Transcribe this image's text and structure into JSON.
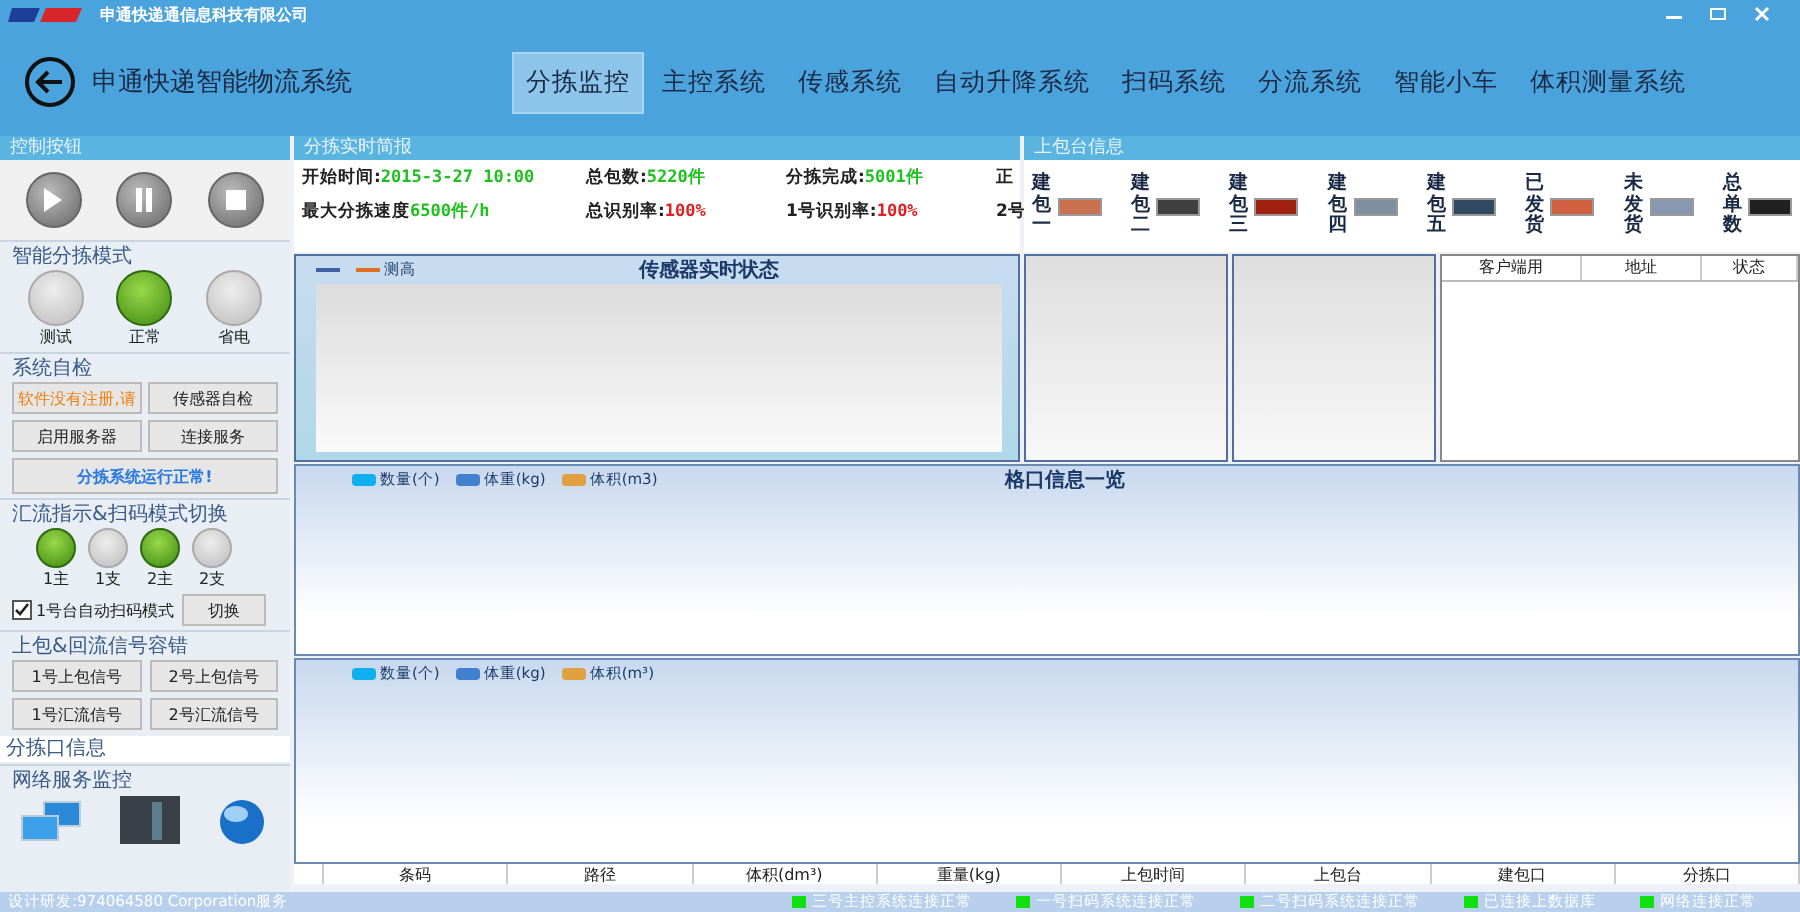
{
  "window": {
    "company": "申通快递通信息科技有限公司",
    "title": "申通快递智能物流系统"
  },
  "tabs": [
    {
      "label": "分拣监控",
      "selected": true
    },
    {
      "label": "主控系统",
      "selected": false
    },
    {
      "label": "传感系统",
      "selected": false
    },
    {
      "label": "自动升降系统",
      "selected": false
    },
    {
      "label": "扫码系统",
      "selected": false
    },
    {
      "label": "分流系统",
      "selected": false
    },
    {
      "label": "智能小车",
      "selected": false
    },
    {
      "label": "体积测量系统",
      "selected": false
    }
  ],
  "control": {
    "title": "控制按钮",
    "sort_mode": {
      "title": "智能分拣模式",
      "lamps": [
        {
          "label": "测试",
          "on": false
        },
        {
          "label": "正常",
          "on": true
        },
        {
          "label": "省电",
          "on": false
        }
      ]
    },
    "self_check": {
      "title": "系统自检",
      "buttons": [
        {
          "label": "软件没有注册,请",
          "kind": "warning"
        },
        {
          "label": "传感器自检",
          "kind": "normal"
        },
        {
          "label": "启用服务器",
          "kind": "normal"
        },
        {
          "label": "连接服务",
          "kind": "normal"
        }
      ],
      "status": "分拣系统运行正常!"
    },
    "merge": {
      "title": "汇流指示&扫码模式切换",
      "lamps": [
        {
          "label": "1主",
          "on": true
        },
        {
          "label": "1支",
          "on": false
        },
        {
          "label": "2主",
          "on": true
        },
        {
          "label": "2支",
          "on": false
        }
      ],
      "auto_scan": {
        "label": "1号台自动扫码模式",
        "checked": true
      },
      "switch_button": "切换"
    },
    "fault": {
      "title": "上包&回流信号容错",
      "buttons": [
        "1号上包信号",
        "2号上包信号",
        "1号汇流信号",
        "2号汇流信号"
      ]
    },
    "sort_port": "分拣口信息",
    "network": {
      "title": "网络服务监控"
    }
  },
  "brief": {
    "title": "分拣实时简报",
    "rows": [
      [
        {
          "label": "开始时间:",
          "value": "2015-3-27 10:00",
          "color": "#20c020"
        },
        {
          "label": "总包数:",
          "value": "5220件",
          "color": "#20c020"
        },
        {
          "label": "分拣完成:",
          "value": "5001件",
          "color": "#20c020"
        },
        {
          "label": "正"
        }
      ],
      [
        {
          "label": "最大分拣速度",
          "value": "6500件/h",
          "color": "#20c020"
        },
        {
          "label": "总识别率:",
          "value": "100%",
          "color": "#e02020"
        },
        {
          "label": "1号识别率:",
          "value": "100%",
          "color": "#e02020"
        },
        {
          "label": "2号"
        }
      ]
    ]
  },
  "platform": {
    "title": "上包台信息",
    "items": [
      {
        "label": "建包一",
        "color": "#c87050"
      },
      {
        "label": "建包二",
        "color": "#404040"
      },
      {
        "label": "建包三",
        "color": "#a02010"
      },
      {
        "label": "建包四",
        "color": "#8090a0"
      },
      {
        "label": "建包五",
        "color": "#304860"
      },
      {
        "label": "已发货",
        "color": "#d06040"
      },
      {
        "label": "未发货",
        "color": "#8898b0"
      },
      {
        "label": "总单数",
        "color": "#202020"
      }
    ]
  },
  "sensor_chart": {
    "title": "传感器实时状态",
    "legend": [
      {
        "color": "#4060a0"
      },
      {
        "label": "测高",
        "color": "#e07020"
      }
    ]
  },
  "client_table": {
    "columns": [
      "客户端用",
      "地址",
      "状态"
    ]
  },
  "port_chart": {
    "title": "格口信息一览",
    "legend": [
      {
        "label": "数量(个)",
        "color": "#10b0f0"
      },
      {
        "label": "体重(kg)",
        "color": "#4080d0"
      },
      {
        "label": "体积(m3)",
        "color": "#e0a040"
      }
    ]
  },
  "port_chart_2": {
    "legend": [
      {
        "label": "数量(个)",
        "color": "#10b0f0"
      },
      {
        "label": "体重(kg)",
        "color": "#4080d0"
      },
      {
        "label": "体积(m³)",
        "color": "#e0a040"
      }
    ]
  },
  "parcel_table": {
    "columns": [
      "条码",
      "路径",
      "体积(dm³)",
      "重量(kg)",
      "上包时间",
      "上包台",
      "建包口",
      "分拣口"
    ]
  },
  "status_bar": {
    "text": "设计研发:974064580 Corporation服务",
    "items": [
      {
        "label": "三号主控系统连接正常",
        "ok": true
      },
      {
        "label": "一号扫码系统连接正常",
        "ok": true
      },
      {
        "label": "二号扫码系统连接正常",
        "ok": true
      },
      {
        "label": "已连接上数据库",
        "ok": true
      },
      {
        "label": "网络连接正常",
        "ok": true
      }
    ]
  }
}
